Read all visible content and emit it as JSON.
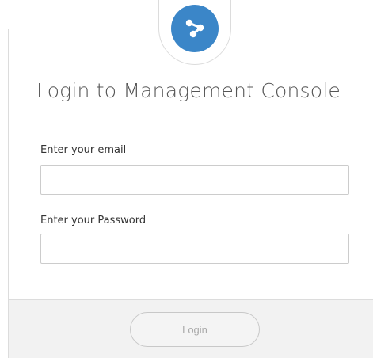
{
  "login": {
    "title": "Login to Management Console",
    "email_label": "Enter your email",
    "email_value": "",
    "password_label": "Enter your Password",
    "password_value": "",
    "submit_label": "Login"
  },
  "colors": {
    "accent": "#3b86c8",
    "footer_bg": "#f2f2f2",
    "border": "#dcdcdc"
  },
  "icons": {
    "logo": "share-nodes-icon"
  }
}
